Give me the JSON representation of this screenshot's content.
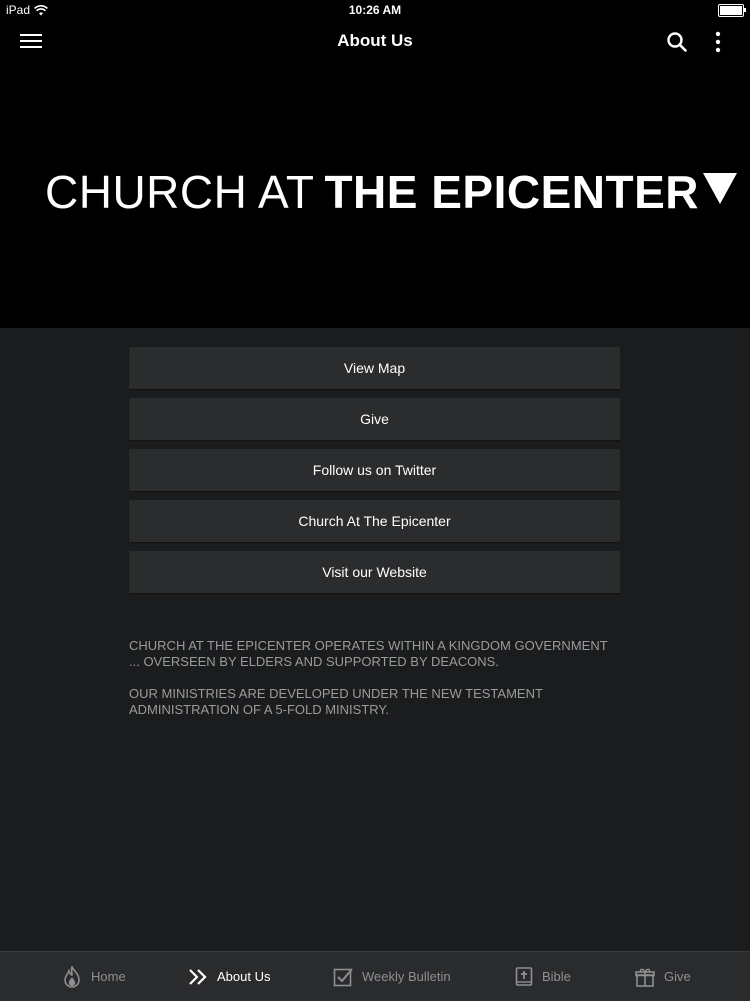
{
  "status_bar": {
    "device": "iPad",
    "time": "10:26 AM"
  },
  "app_bar": {
    "title": "About Us",
    "icons": [
      "menu-icon",
      "search-icon",
      "more-vertical-icon"
    ]
  },
  "hero": {
    "logo_light": "CHURCH AT",
    "logo_bold": "THE EPICENTER"
  },
  "buttons": [
    {
      "label": "View Map"
    },
    {
      "label": "Give"
    },
    {
      "label": "Follow us on Twitter"
    },
    {
      "label": "Church At The Epicenter"
    },
    {
      "label": "Visit our Website"
    }
  ],
  "description": {
    "paragraph1": "CHURCH AT THE EPICENTER OPERATES WITHIN A KINGDOM GOVERNMENT ... OVERSEEN BY ELDERS AND SUPPORTED BY DEACONS.",
    "paragraph2": "OUR MINISTRIES ARE DEVELOPED UNDER THE NEW TESTAMENT ADMINISTRATION OF A 5-FOLD MINISTRY."
  },
  "tabs": [
    {
      "label": "Home",
      "icon": "flame-icon",
      "active": false
    },
    {
      "label": "About Us",
      "icon": "double-chevron-right-icon",
      "active": true
    },
    {
      "label": "Weekly Bulletin",
      "icon": "checkbox-icon",
      "active": false
    },
    {
      "label": "Bible",
      "icon": "bible-icon",
      "active": false
    },
    {
      "label": "Give",
      "icon": "gift-icon",
      "active": false
    }
  ],
  "colors": {
    "background": "#1b1c1d",
    "header": "#000000",
    "button": "#2b2c2e",
    "tab_bar": "#2a2b2d",
    "muted_text": "#9a9b9c"
  }
}
